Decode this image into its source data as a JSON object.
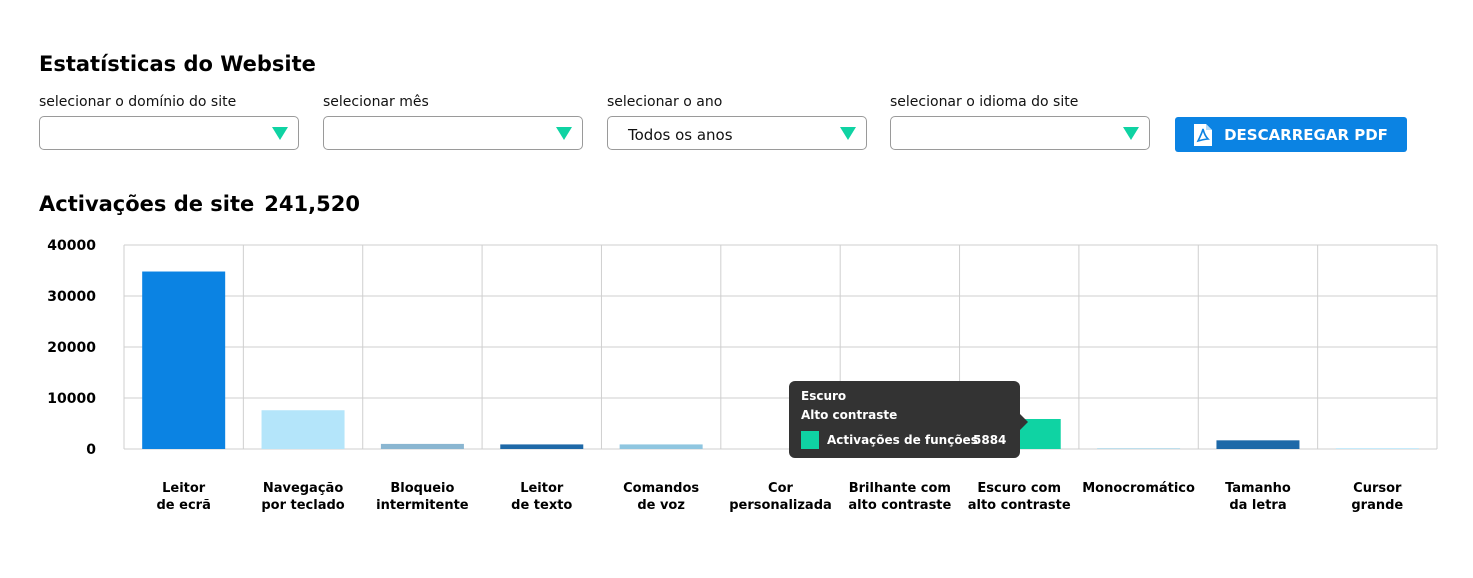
{
  "page_title": "Estatísticas do Website",
  "filters": [
    {
      "label": "selecionar o domínio do site",
      "value": ""
    },
    {
      "label": "selecionar mês",
      "value": ""
    },
    {
      "label": "selecionar o ano",
      "value": "Todos os anos"
    },
    {
      "label": "selecionar o idioma do site",
      "value": ""
    }
  ],
  "pdf_button": {
    "label": "DESCARREGAR PDF",
    "icon": "pdf-file-icon"
  },
  "section": {
    "title": "Activações de site",
    "total": "241,520"
  },
  "colors": {
    "accent": "#0b83e3",
    "caret": "#0fd3a3",
    "tooltip_bg": "#333333"
  },
  "tooltip": {
    "line1": "Escuro",
    "line2": "Alto contraste",
    "series_label": "Activações de funções",
    "value": "5884",
    "swatch_color": "#0fd3a3"
  },
  "chart_data": {
    "type": "bar",
    "categories": [
      [
        "Leitor",
        "de ecrã"
      ],
      [
        "Navegação",
        "por teclado"
      ],
      [
        "Bloqueio",
        "intermitente"
      ],
      [
        "Leitor",
        "de texto"
      ],
      [
        "Comandos",
        "de voz"
      ],
      [
        "Cor",
        "personalizada"
      ],
      [
        "Brilhante com",
        "alto contraste"
      ],
      [
        "Escuro com",
        "alto contraste"
      ],
      [
        "Monocromático"
      ],
      [
        "Tamanho",
        "da letra"
      ],
      [
        "Cursor",
        "grande"
      ]
    ],
    "series": [
      {
        "values": [
          34800,
          7600,
          1000,
          900,
          900,
          0,
          0,
          5884,
          150,
          1700,
          150
        ],
        "colors": [
          "#0b83e3",
          "#b4e5fa",
          "#8ab6d1",
          "#1e69a8",
          "#8fc6e0",
          "#cccccc",
          "#cccccc",
          "#0fd3a3",
          "#a9d4e6",
          "#1e69a8",
          "#b4e5fa"
        ]
      }
    ],
    "yticks": [
      0,
      10000,
      20000,
      30000,
      40000
    ],
    "ylim": [
      0,
      40000
    ],
    "grid": true,
    "xlabel": "",
    "ylabel": ""
  }
}
